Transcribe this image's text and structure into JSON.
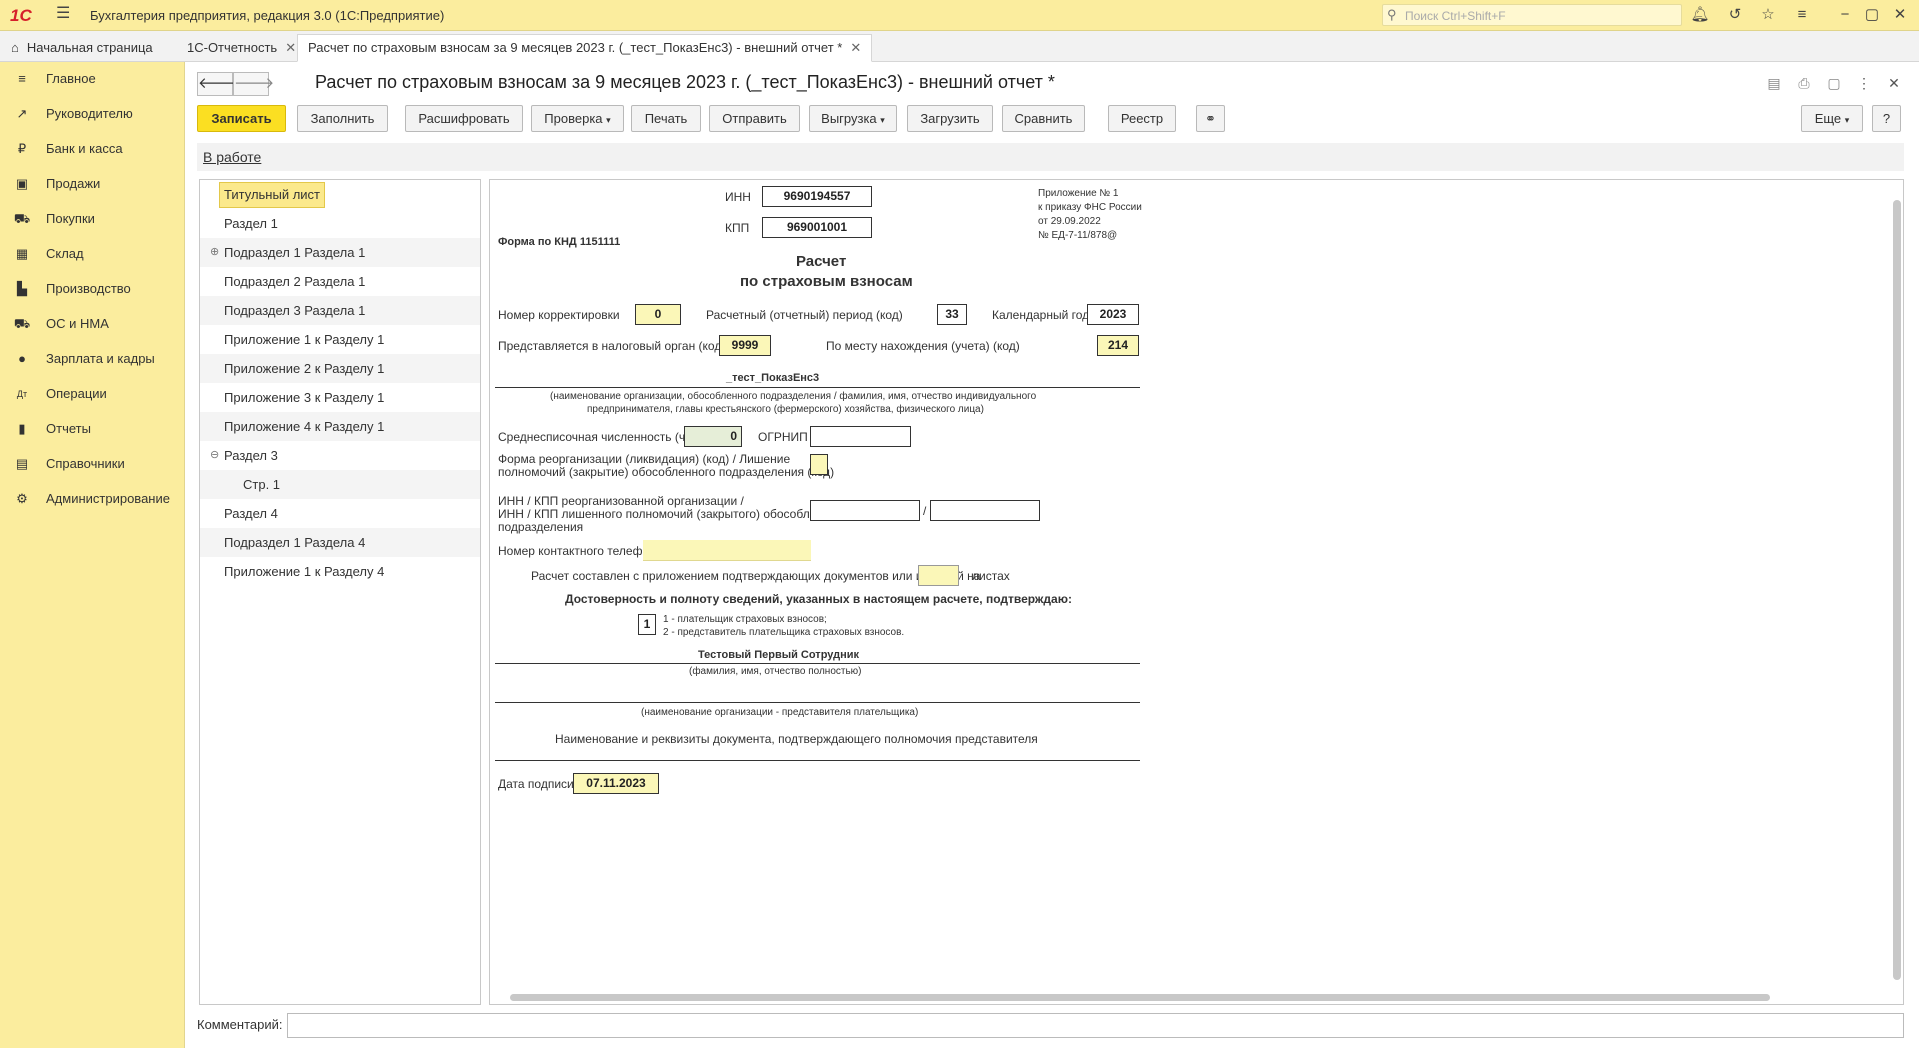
{
  "app": {
    "logo": "1С",
    "title": "Бухгалтерия предприятия, редакция 3.0  (1С:Предприятие)",
    "search_placeholder": "Поиск Ctrl+Shift+F"
  },
  "tabs": [
    {
      "label": "Начальная страница"
    },
    {
      "label": "1С-Отчетность"
    },
    {
      "label": "Расчет по страховым взносам за 9 месяцев 2023 г. (_тест_ПоказЕнс3) - внешний отчет *"
    }
  ],
  "sidebar": {
    "items": [
      {
        "label": "Главное",
        "icon": "≡"
      },
      {
        "label": "Руководителю",
        "icon": "↗"
      },
      {
        "label": "Банк и касса",
        "icon": "₽"
      },
      {
        "label": "Продажи",
        "icon": "▣"
      },
      {
        "label": "Покупки",
        "icon": "⛟"
      },
      {
        "label": "Склад",
        "icon": "▦"
      },
      {
        "label": "Производство",
        "icon": "▙"
      },
      {
        "label": "ОС и НМА",
        "icon": "⛟"
      },
      {
        "label": "Зарплата и кадры",
        "icon": "●"
      },
      {
        "label": "Операции",
        "icon": "Дт"
      },
      {
        "label": "Отчеты",
        "icon": "▮"
      },
      {
        "label": "Справочники",
        "icon": "▤"
      },
      {
        "label": "Администрирование",
        "icon": "⚙"
      }
    ]
  },
  "document": {
    "title": "Расчет по страховым взносам за 9 месяцев 2023 г. (_тест_ПоказЕнс3) - внешний отчет *",
    "status": "В работе"
  },
  "toolbar": {
    "save": "Записать",
    "fill": "Заполнить",
    "decode": "Расшифровать",
    "check": "Проверка",
    "print": "Печать",
    "send": "Отправить",
    "export": "Выгрузка",
    "load": "Загрузить",
    "compare": "Сравнить",
    "registry": "Реестр",
    "more": "Еще",
    "help": "?"
  },
  "tree": {
    "items": [
      {
        "label": "Титульный лист"
      },
      {
        "label": "Раздел 1"
      },
      {
        "label": "Подраздел 1 Раздела 1"
      },
      {
        "label": "Подраздел 2 Раздела 1"
      },
      {
        "label": "Подраздел 3 Раздела 1"
      },
      {
        "label": "Приложение 1 к Разделу 1"
      },
      {
        "label": "Приложение 2 к Разделу 1"
      },
      {
        "label": "Приложение 3 к Разделу 1"
      },
      {
        "label": "Приложение 4 к Разделу 1"
      },
      {
        "label": "Раздел 3"
      },
      {
        "label": "Стр. 1"
      },
      {
        "label": "Раздел 4"
      },
      {
        "label": "Подраздел 1 Раздела 4"
      },
      {
        "label": "Приложение 1 к Разделу 4"
      }
    ]
  },
  "form": {
    "inn_label": "ИНН",
    "inn": "9690194557",
    "kpp_label": "КПП",
    "kpp": "969001001",
    "appendix_1": "Приложение № 1",
    "appendix_2": "к приказу ФНС России",
    "appendix_3": "от 29.09.2022",
    "appendix_4": "№ ЕД-7-11/878@",
    "knd": "Форма по КНД 1151111",
    "heading_1": "Расчет",
    "heading_2": "по страховым взносам",
    "correction_label": "Номер корректировки",
    "correction": "0",
    "period_label": "Расчетный (отчетный) период (код)",
    "period": "33",
    "year_label": "Календарный год",
    "year": "2023",
    "tax_org_label": "Представляется в налоговый орган (код)",
    "tax_org": "9999",
    "location_label": "По месту нахождения (учета) (код)",
    "location": "214",
    "org_name": "_тест_ПоказЕнс3",
    "org_caption_1": "(наименование организации, обособленного подразделения / фамилия, имя, отчество индивидуального",
    "org_caption_2": "предпринимателя, главы крестьянского (фермерского) хозяйства, физического лица)",
    "headcount_label": "Среднесписочная численность (чел.)",
    "headcount": "0",
    "ogrnip_label": "ОГРНИП",
    "reorg_label_1": "Форма реорганизации (ликвидация) (код) / Лишение",
    "reorg_label_2": "полномочий (закрытие) обособленного подразделения (код)",
    "reorg_inn_1": "ИНН / КПП реорганизованной организации /",
    "reorg_inn_2": "ИНН / КПП лишенного полномочий (закрытого) обособленного",
    "reorg_inn_3": "подразделения",
    "slash": "/",
    "phone_label": "Номер контактного телефона",
    "pages_label": "Расчет составлен с приложением подтверждающих документов или их копий на",
    "pages_suffix": "листах",
    "confirm": "Достоверность и полноту сведений, указанных в настоящем расчете, подтверждаю:",
    "signer_code": "1",
    "signer_opt_1": "1 - плательщик страховых взносов;",
    "signer_opt_2": "2 - представитель плательщика страховых взносов.",
    "signer_name": "Тестовый Первый Сотрудник",
    "signer_caption": "(фамилия, имя, отчество полностью)",
    "rep_caption": "(наименование организации - представителя плательщика)",
    "rep_doc": "Наименование и реквизиты документа, подтверждающего полномочия представителя",
    "date_label": "Дата подписи",
    "date": "07.11.2023"
  },
  "comment_label": "Комментарий:"
}
